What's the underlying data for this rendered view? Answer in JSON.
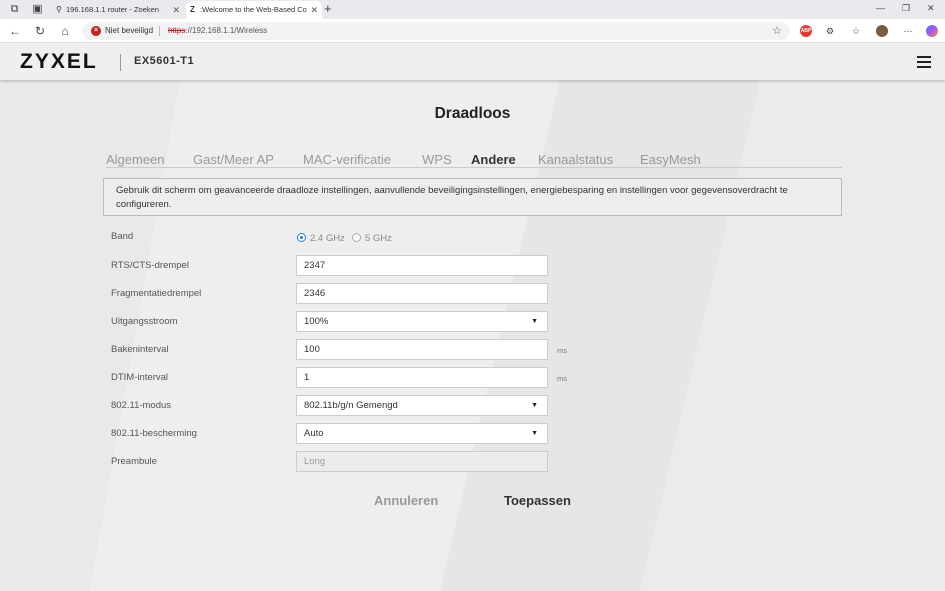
{
  "browser": {
    "tabs": [
      {
        "title": "196.168.1.1 router - Zoeken",
        "icon": "search-icon"
      },
      {
        "title": ":Welcome to the Web-Based Co",
        "icon": "Z"
      }
    ],
    "security_label": "Niet beveiligd",
    "url_protocol": "https",
    "url_rest": "://192.168.1.1/Wireless"
  },
  "header": {
    "logo": "ZYXEL",
    "model": "EX5601-T1"
  },
  "page": {
    "title": "Draadloos",
    "tabs": [
      {
        "label": "Algemeen",
        "active": false
      },
      {
        "label": "Gast/Meer AP",
        "active": false
      },
      {
        "label": "MAC-verificatie",
        "active": false
      },
      {
        "label": "WPS",
        "active": false
      },
      {
        "label": "Andere",
        "active": true
      },
      {
        "label": "Kanaalstatus",
        "active": false
      },
      {
        "label": "EasyMesh",
        "active": false
      }
    ],
    "description": "Gebruik dit scherm om geavanceerde draadloze instellingen, aanvullende beveiligingsinstellingen, energiebesparing en instellingen voor gegevensoverdracht te configureren."
  },
  "form": {
    "band": {
      "label": "Band",
      "options": [
        "2.4 GHz",
        "5 GHz"
      ],
      "selected": "2.4 GHz"
    },
    "rts": {
      "label": "RTS/CTS-drempel",
      "value": "2347"
    },
    "frag": {
      "label": "Fragmentatiedrempel",
      "value": "2346"
    },
    "power": {
      "label": "Uitgangsstroom",
      "value": "100%"
    },
    "beacon": {
      "label": "Bakeninterval",
      "value": "100",
      "unit": "ms"
    },
    "dtim": {
      "label": "DTIM-interval",
      "value": "1",
      "unit": "ms"
    },
    "mode": {
      "label": "802.11-modus",
      "value": "802.11b/g/n Gemengd"
    },
    "protection": {
      "label": "802.11-bescherming",
      "value": "Auto"
    },
    "preamble": {
      "label": "Preambule",
      "value": "Long"
    }
  },
  "actions": {
    "cancel": "Annuleren",
    "apply": "Toepassen"
  },
  "colors": {
    "accent": "#7c6cf0",
    "radio": "#2f7bd6"
  }
}
